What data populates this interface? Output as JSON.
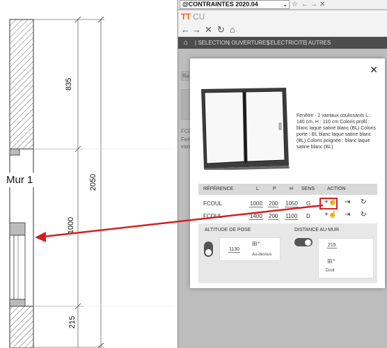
{
  "drawing": {
    "wall_label": "Mur 1",
    "dims": {
      "top": "835",
      "middle": "1000",
      "bottom": "215",
      "total": "2050"
    }
  },
  "browser": {
    "url": "@CONTRAINTES 2020.04",
    "icons": [
      "chevron-down-icon",
      "star-icon",
      "back-icon",
      "forward-icon",
      "close-icon"
    ]
  },
  "app": {
    "logo_primary": "TT",
    "logo_secondary": "CU",
    "nav_icons": [
      "back-arrow-icon",
      "forward-arrow-icon",
      "close-icon",
      "refresh-icon",
      "home-icon"
    ]
  },
  "menu": {
    "items": [
      "SELECTION",
      "OUVERTURES",
      "ELECTRICITE",
      "AUTRES"
    ]
  },
  "background": {
    "tab_fragment": "Re",
    "label_fragment": "FCO",
    "text_fragment_1": "Fen",
    "text_fragment_2": "van"
  },
  "modal": {
    "close_label": "✕",
    "description": "Fenêtre - 2 vantaux coulissants L : 140 cm. H : 110 cm Coloris profil : blanc laque satine blanc (BL) Coloris porte : BL blanc laque satine blanc (BL) Coloris poignée : blanc laque satine blanc (BL)",
    "table": {
      "headers": [
        "RÉFÉRENCE",
        "L",
        "P",
        "H",
        "SENS",
        "ACTION"
      ],
      "rows": [
        {
          "ref": "FCOUL",
          "l": "1000",
          "p": "200",
          "h": "1050",
          "sens": "G"
        },
        {
          "ref": "FCOUL",
          "l": "1400",
          "p": "200",
          "h": "1100",
          "sens": "D"
        }
      ]
    },
    "altitude": {
      "title": "ALTITUDE DE POSE",
      "value": "1130",
      "option_label": "Au-dessus"
    },
    "distance": {
      "title": "DISTANCE AU MUR",
      "value": "215",
      "option_label": "Droit"
    }
  },
  "colors": {
    "accent": "#ff6600",
    "highlight": "#d42020",
    "menu_bg": "#4d4d4d"
  }
}
